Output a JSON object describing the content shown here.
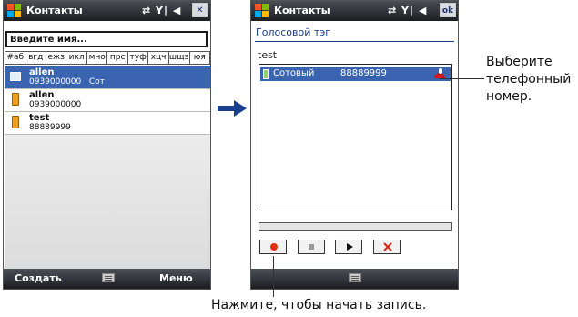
{
  "left": {
    "title": "Контакты",
    "status_icons": "⇄ Y| ◀",
    "close": "✕",
    "search_value": "Введите имя...",
    "alpha_tabs": [
      "#аб",
      "вгд",
      "ежз",
      "икл",
      "мно",
      "прс",
      "туф",
      "хцч",
      "шщэ",
      "юя"
    ],
    "contacts": [
      {
        "name": "allen",
        "detail": "0939000000   Сот",
        "selected": true,
        "icon": "contact-card-icon"
      },
      {
        "name": "allen",
        "detail": "0939000000",
        "selected": false,
        "icon": "phone-icon"
      },
      {
        "name": "test",
        "detail": "88889999",
        "selected": false,
        "icon": "phone-icon"
      }
    ],
    "softkey_left": "Создать",
    "softkey_right": "Меню"
  },
  "right": {
    "title": "Контакты",
    "status_icons": "⇄ Y| ◀",
    "ok": "ok",
    "heading": "Голосовой тэг",
    "contact_name": "test",
    "number_item": {
      "label": "Сотовый",
      "number": "88889999"
    }
  },
  "callouts": {
    "right_text": "Выберите телефонный номер.",
    "bottom_text": "Нажмите, чтобы начать запись."
  },
  "colors": {
    "heading": "#1c3b8a",
    "selection": "#3a64b0",
    "arrow": "#1a3f8c",
    "record": "#e03010",
    "delete": "#d02a1a"
  }
}
